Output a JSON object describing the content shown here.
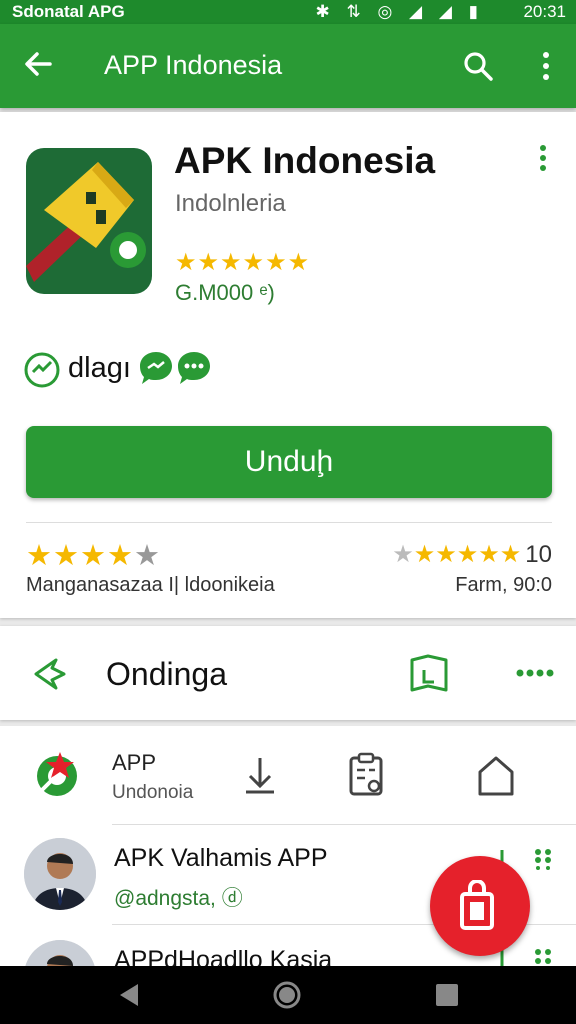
{
  "status_bar": {
    "carrier": "Sdonatal APG",
    "icons": "✱ ⇅ ◎ ◢ ◢ ▮",
    "time": "20:31"
  },
  "app_bar": {
    "title": "APP Indonesia"
  },
  "app": {
    "name": "APK Indonesia",
    "developer": "Indolnleria",
    "stars": "★★★★★★",
    "count": "G.M000 ᵉ)",
    "badge_label": "dlagı",
    "download_label": "Unduḩ"
  },
  "ratings": {
    "left_stars_on": "★★★★",
    "left_stars_off": "★",
    "left_label": "Manganasazaa  I| ldoonikeia",
    "right_stars_off": "★",
    "right_stars_on": "★★★★★",
    "right_number": "10",
    "right_label": "Farm, 90:0"
  },
  "section": {
    "label": "Ondinga"
  },
  "list": {
    "row1": {
      "title": "APP",
      "subtitle": "Undonoia"
    },
    "row2": {
      "title": "APK Valhamis APP",
      "subtitle": "@adngsta, ⓓ"
    },
    "row3": {
      "title": "APPdHoadllo Kasia"
    }
  },
  "colors": {
    "green": "#2a9a35",
    "status_green": "#1e8a2c",
    "star": "#f5b800",
    "fab_red": "#e5212b"
  }
}
